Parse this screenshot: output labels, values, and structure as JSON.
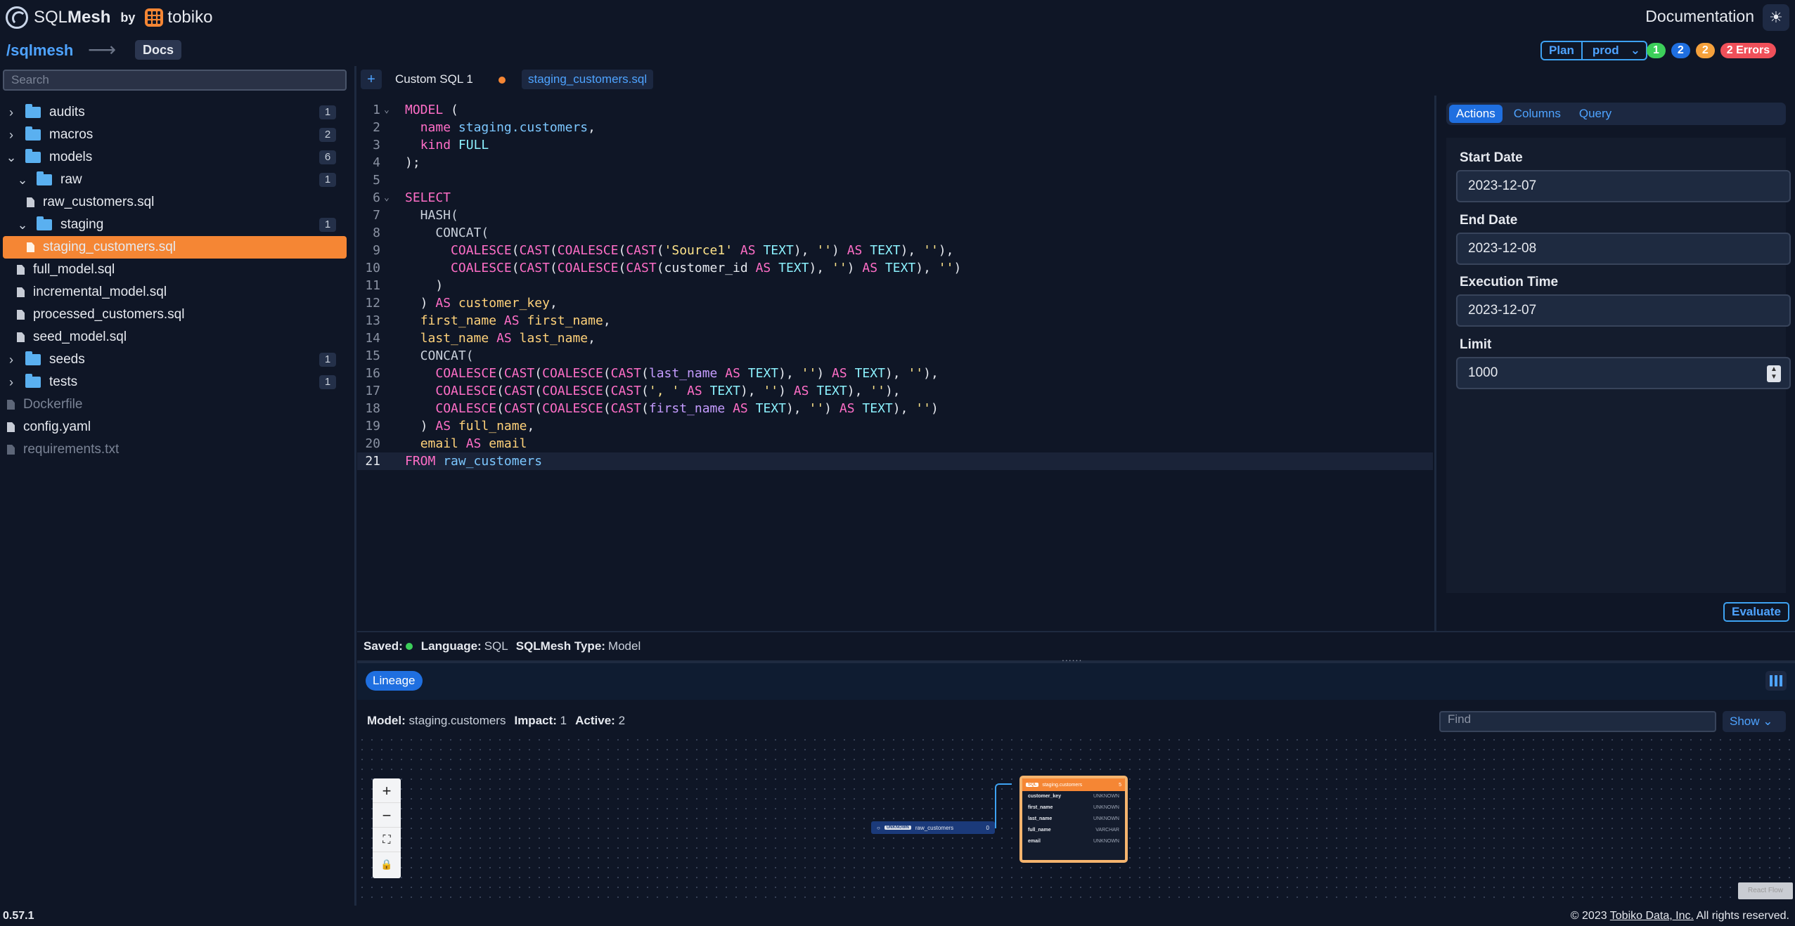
{
  "header": {
    "logo_sql": "SQL",
    "logo_mesh": "Mesh",
    "logo_by": "by",
    "logo_tobiko": "tobiko",
    "documentation": "Documentation",
    "theme_icon": "sun-icon"
  },
  "subheader": {
    "project": "/sqlmesh",
    "docs_tab": "Docs",
    "plan": "Plan",
    "environment": "prod",
    "badges": [
      {
        "label": "1",
        "color": "#3ccf5a"
      },
      {
        "label": "2",
        "color": "#1f6fe0"
      },
      {
        "label": "2",
        "color": "#f5a13c"
      },
      {
        "label": "2 Errors",
        "color": "#f0505a"
      }
    ]
  },
  "sidebar": {
    "search_placeholder": "Search",
    "items": [
      {
        "type": "folder",
        "label": "audits",
        "count": "1"
      },
      {
        "type": "folder",
        "label": "macros",
        "count": "2"
      },
      {
        "type": "folder",
        "label": "models",
        "count": "6"
      },
      {
        "type": "folder",
        "label": "raw",
        "count": "1"
      },
      {
        "type": "file",
        "label": "raw_customers.sql"
      },
      {
        "type": "folder",
        "label": "staging",
        "count": "1"
      },
      {
        "type": "file",
        "label": "staging_customers.sql"
      },
      {
        "type": "file",
        "label": "full_model.sql"
      },
      {
        "type": "file",
        "label": "incremental_model.sql"
      },
      {
        "type": "file",
        "label": "processed_customers.sql"
      },
      {
        "type": "file",
        "label": "seed_model.sql"
      },
      {
        "type": "folder",
        "label": "seeds",
        "count": "1"
      },
      {
        "type": "folder",
        "label": "tests",
        "count": "1"
      },
      {
        "type": "file",
        "label": "Dockerfile"
      },
      {
        "type": "file",
        "label": "config.yaml"
      },
      {
        "type": "file",
        "label": "requirements.txt"
      }
    ]
  },
  "tabs": {
    "add": "+",
    "tab1": "Custom SQL 1",
    "tab2": "staging_customers.sql"
  },
  "editor": {
    "line_numbers": [
      "1",
      "2",
      "3",
      "4",
      "5",
      "6",
      "7",
      "8",
      "9",
      "10",
      "11",
      "12",
      "13",
      "14",
      "15",
      "16",
      "17",
      "18",
      "19",
      "20",
      "21"
    ],
    "current_line": "21"
  },
  "right_panel": {
    "tabs": [
      "Actions",
      "Columns",
      "Query"
    ],
    "start_date_label": "Start Date",
    "start_date": "2023-12-07",
    "end_date_label": "End Date",
    "end_date": "2023-12-08",
    "execution_time_label": "Execution Time",
    "execution_time": "2023-12-07",
    "limit_label": "Limit",
    "limit": "1000",
    "evaluate": "Evaluate"
  },
  "status": {
    "saved_label": "Saved:",
    "language_label": "Language:",
    "language": "SQL",
    "type_label": "SQLMesh Type:",
    "type": "Model"
  },
  "lineage": {
    "tab": "Lineage",
    "model_label": "Model:",
    "model": "staging.customers",
    "impact_label": "Impact:",
    "impact": "1",
    "active_label": "Active:",
    "active": "2",
    "find_placeholder": "Find",
    "show": "Show",
    "node_raw": {
      "tag": "UNKNOWN",
      "name": "raw_customers",
      "count": "0"
    },
    "node_stg": {
      "tag": "SQL",
      "name": "staging.customers",
      "count": "5",
      "columns": [
        {
          "name": "customer_key",
          "type": "UNKNOWN"
        },
        {
          "name": "first_name",
          "type": "UNKNOWN"
        },
        {
          "name": "last_name",
          "type": "UNKNOWN"
        },
        {
          "name": "full_name",
          "type": "VARCHAR"
        },
        {
          "name": "email",
          "type": "UNKNOWN"
        }
      ]
    },
    "minimap": "React Flow"
  },
  "footer": {
    "version": "0.57.1",
    "copyright_prefix": "© 2023",
    "company": "Tobiko Data, Inc.",
    "copyright_suffix": "All rights reserved."
  }
}
